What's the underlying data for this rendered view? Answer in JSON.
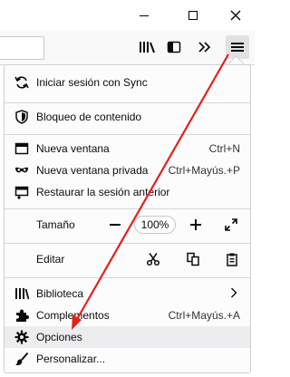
{
  "menu_items": {
    "sync": "Iniciar sesión con Sync",
    "content_blocking": "Bloqueo de contenido",
    "new_window": "Nueva ventana",
    "new_window_shortcut": "Ctrl+N",
    "private_window": "Nueva ventana privada",
    "private_window_shortcut": "Ctrl+Mayús.+P",
    "restore_session": "Restaurar la sesión anterior",
    "zoom_label": "Tamaño",
    "zoom_value": "100%",
    "edit_label": "Editar",
    "library": "Biblioteca",
    "addons": "Complementos",
    "addons_shortcut": "Ctrl+Mayús.+A",
    "options": "Opciones",
    "customize": "Personalizar..."
  },
  "icons": {
    "window_controls": [
      "minimize-icon",
      "maximize-icon",
      "close-icon"
    ],
    "toolbar": [
      "library-icon",
      "sidebar-icon",
      "overflow-icon",
      "hamburger-menu-icon"
    ]
  },
  "annotation": {
    "arrow_color": "#e2211c"
  }
}
